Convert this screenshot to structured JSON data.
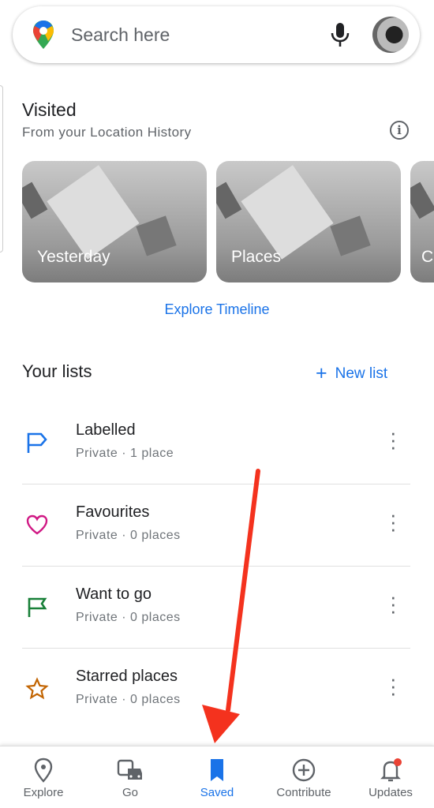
{
  "search": {
    "placeholder": "Search here"
  },
  "visited": {
    "title": "Visited",
    "subtitle": "From your Location History",
    "cards": [
      {
        "label": "Yesterday"
      },
      {
        "label": "Places"
      },
      {
        "label": "C"
      }
    ],
    "explore_link": "Explore Timeline"
  },
  "lists": {
    "title": "Your lists",
    "new_list": "New list",
    "new_list_icon": "+",
    "items": [
      {
        "title": "Labelled",
        "meta": "Private · 1 place",
        "icon": "label-flag-icon",
        "color": "#1a73e8"
      },
      {
        "title": "Favourites",
        "meta": "Private · 0 places",
        "icon": "heart-icon",
        "color": "#d01884"
      },
      {
        "title": "Want to go",
        "meta": "Private · 0 places",
        "icon": "flag-icon",
        "color": "#188038"
      },
      {
        "title": "Starred places",
        "meta": "Private · 0 places",
        "icon": "star-icon",
        "color": "#c26401"
      }
    ]
  },
  "nav": {
    "items": [
      {
        "label": "Explore"
      },
      {
        "label": "Go"
      },
      {
        "label": "Saved",
        "active": true
      },
      {
        "label": "Contribute"
      },
      {
        "label": "Updates"
      }
    ]
  },
  "colors": {
    "accent": "#1a73e8",
    "annotation_arrow": "#f4321e"
  }
}
